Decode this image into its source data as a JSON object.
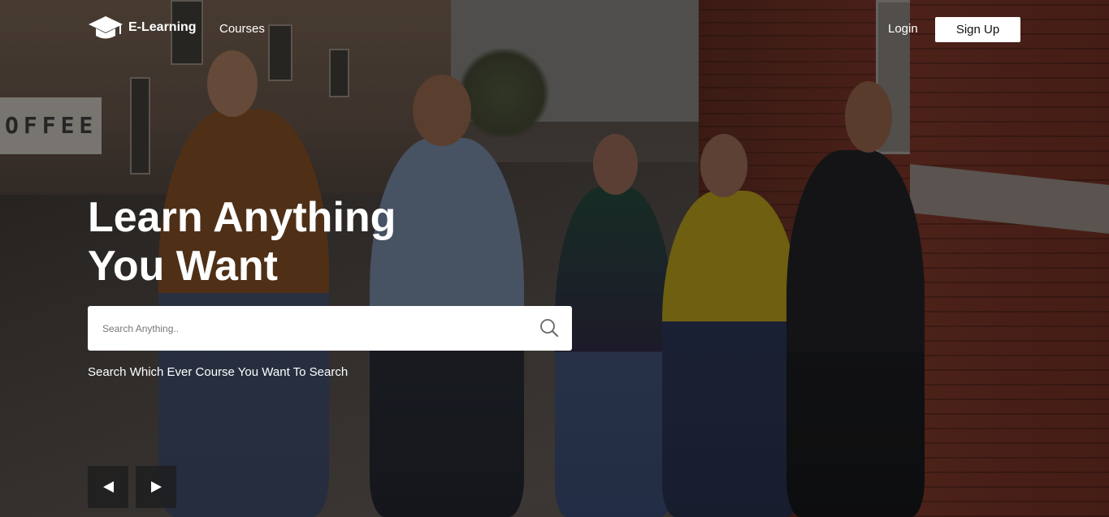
{
  "header": {
    "brand": "E-Learning",
    "nav": {
      "courses": "Courses"
    },
    "login": "Login",
    "signup": "Sign Up"
  },
  "hero": {
    "title_line1": "Learn Anything",
    "title_line2": "You Want",
    "search": {
      "placeholder": "Search Anything..",
      "value": "",
      "icon": "search-icon"
    },
    "subtitle": "Search Which Ever Course You Want To Search",
    "carousel": {
      "prev_icon": "arrow-left-icon",
      "next_icon": "arrow-right-icon"
    }
  },
  "background_text": {
    "shop_sign": "OFFEE"
  },
  "colors": {
    "button_bg": "#ffffff",
    "text": "#ffffff",
    "arrow_bg": "#1e1e1e"
  }
}
